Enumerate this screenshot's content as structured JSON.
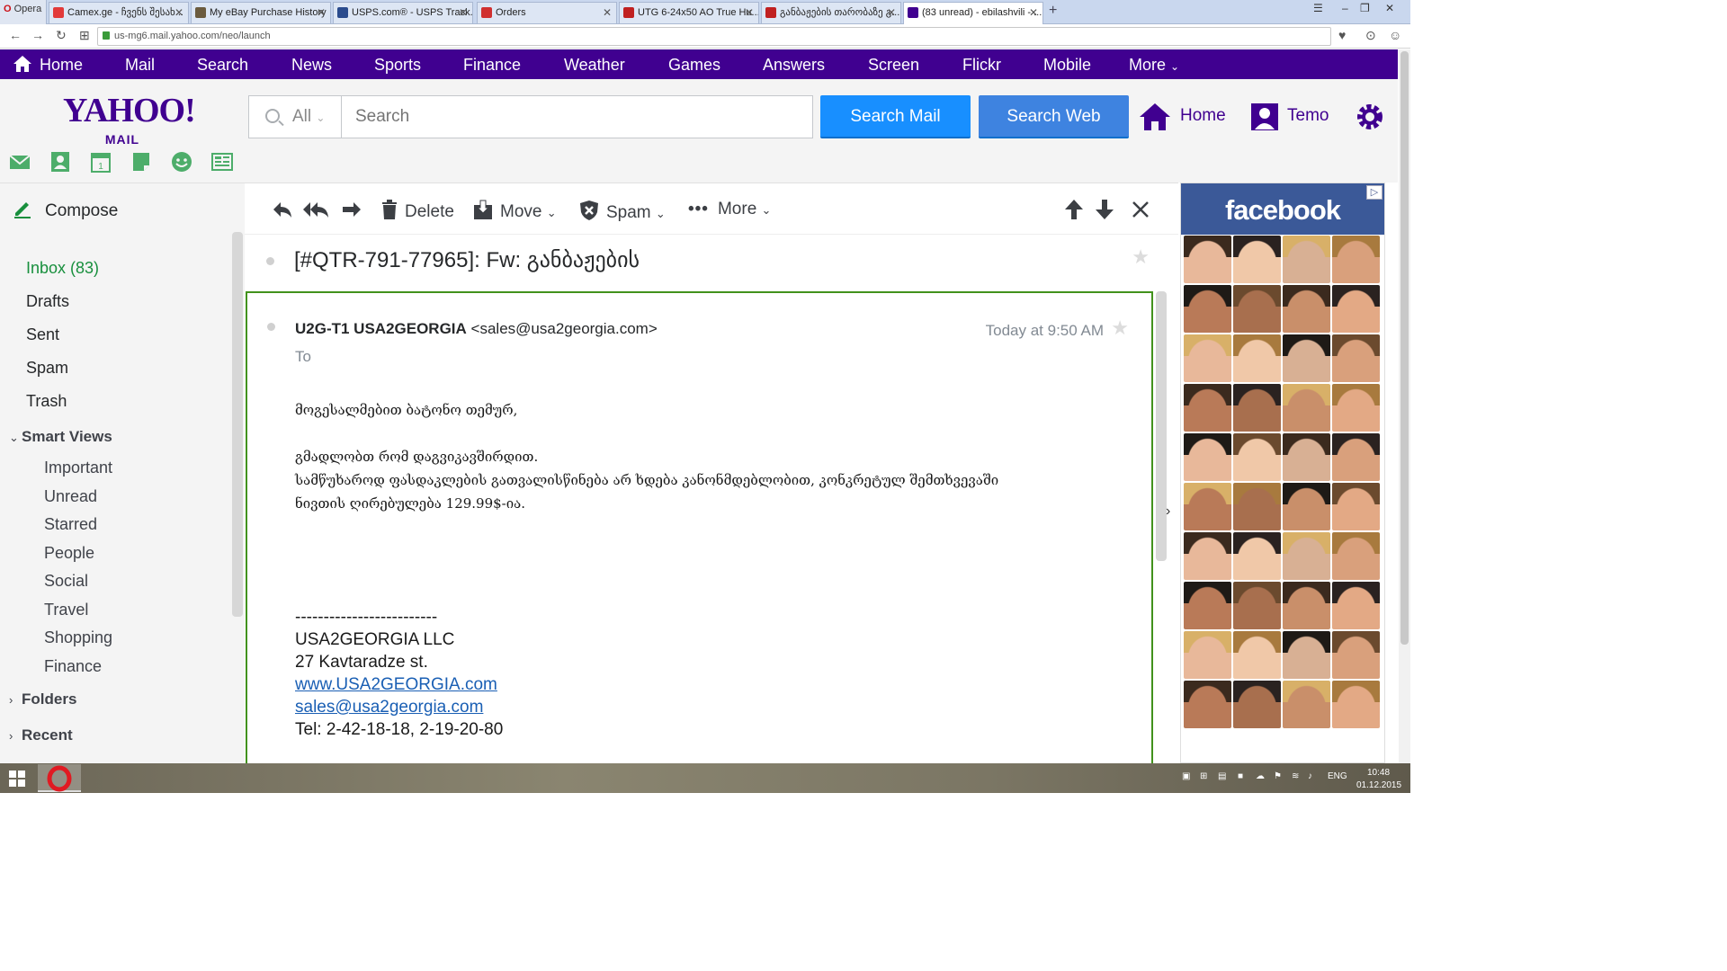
{
  "browser": {
    "opera_label": "Opera",
    "tabs": [
      {
        "title": "Camex.ge - ჩვენს შესახ...",
        "color": "#e23a3a"
      },
      {
        "title": "My eBay Purchase History",
        "color": "#6b5b3e"
      },
      {
        "title": "USPS.com® - USPS Track...",
        "color": "#2a4b8d"
      },
      {
        "title": "Orders",
        "color": "#d03030"
      },
      {
        "title": "UTG 6-24x50 AO True Hu...",
        "color": "#c02020"
      },
      {
        "title": "განბაჟების თარობაზე გ...",
        "color": "#c02020"
      },
      {
        "title": "(83 unread) - ebilashvili - ...",
        "color": "#400090"
      }
    ],
    "url": "us-mg6.mail.yahoo.com/neo/launch"
  },
  "yahoo_nav": {
    "items": [
      "Home",
      "Mail",
      "Search",
      "News",
      "Sports",
      "Finance",
      "Weather",
      "Games",
      "Answers",
      "Screen",
      "Flickr",
      "Mobile",
      "More"
    ]
  },
  "header": {
    "logo_top": "YAHOO!",
    "logo_sub": "MAIL",
    "search_scope": "All",
    "search_placeholder": "Search",
    "search_mail": "Search Mail",
    "search_web": "Search Web",
    "home_label": "Home",
    "user_name": "Temo"
  },
  "sidebar": {
    "compose": "Compose",
    "folders": [
      "Inbox (83)",
      "Drafts",
      "Sent",
      "Spam",
      "Trash"
    ],
    "smart_views_label": "Smart Views",
    "smart_views": [
      "Important",
      "Unread",
      "Starred",
      "People",
      "Social",
      "Travel",
      "Shopping",
      "Finance"
    ],
    "folders_label": "Folders",
    "recent_label": "Recent"
  },
  "toolbar": {
    "delete": "Delete",
    "move": "Move",
    "spam": "Spam",
    "more": "More"
  },
  "message": {
    "subject": "[#QTR-791-77965]: Fw: განბაჟების",
    "from_name": "U2G-T1 USA2GEORGIA",
    "from_email": "<sales@usa2georgia.com>",
    "date": "Today at 9:50 AM",
    "to_label": "To",
    "greeting": "მოგესალმებით ბატონო თემურ,",
    "line1": "გმადლობთ რომ დაგვიკავშირდით.",
    "line2": "სამწუხაროდ ფასდაკლების გათვალისწინება არ ხდება კანონმდებლობით, კონკრეტულ შემთხვევაში",
    "line3": "ნივთის ღირებულება 129.99$-ია.",
    "sig_divider": "-------------------------",
    "sig_company": "USA2GEORGIA LLC",
    "sig_address": "27 Kavtaradze st.",
    "sig_web": "www.USA2GEORGIA.com",
    "sig_email": "sales@usa2georgia.com",
    "sig_tel": "Tel: 2-42-18-18, 2-19-20-80"
  },
  "ad": {
    "brand": "facebook"
  },
  "taskbar": {
    "lang": "ENG",
    "time": "10:48",
    "date": "01.12.2015"
  },
  "colors": {
    "yahoo_purple": "#400090",
    "search_blue": "#188fff",
    "inbox_green": "#188f3d",
    "message_border": "#42921c",
    "facebook_blue": "#3b5998"
  }
}
